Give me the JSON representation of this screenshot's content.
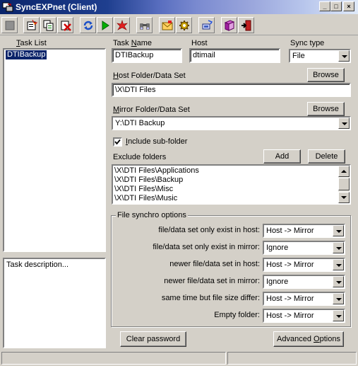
{
  "window": {
    "title": "SyncEXPnet (Client)",
    "minimize_glyph": "_",
    "maximize_glyph": "□",
    "close_glyph": "×"
  },
  "colors": {
    "title_bar": "#0a246a",
    "selection": "#0a246a",
    "face": "#d4d0c8"
  },
  "toolbar": {
    "buttons": [
      {
        "name": "stop-square-icon"
      },
      {
        "name": "new-task-icon"
      },
      {
        "name": "copy-task-icon"
      },
      {
        "name": "delete-task-icon"
      },
      {
        "name": "refresh-sync-icon"
      },
      {
        "name": "play-icon"
      },
      {
        "name": "burst-run-icon"
      },
      {
        "name": "binoculars-icon"
      },
      {
        "name": "mail-icon"
      },
      {
        "name": "gear-settings-icon"
      },
      {
        "name": "computer-network-icon"
      },
      {
        "name": "help-book-icon"
      },
      {
        "name": "exit-door-icon"
      }
    ]
  },
  "task_list": {
    "label_u": "T",
    "label_rest": "ask List",
    "items": [
      "DTIBackup"
    ],
    "description": "Task description..."
  },
  "task": {
    "name_label_pre": "Task ",
    "name_label_u": "N",
    "name_label_post": "ame",
    "name_value": "DTIBackup",
    "host_label": "Host",
    "host_value": "dtimail",
    "sync_type_label": "Sync type",
    "sync_type_value": "File"
  },
  "host_folder": {
    "label_u": "H",
    "label_rest": "ost Folder/Data Set",
    "value": "\\X\\DTI Files",
    "browse_label": "Browse"
  },
  "mirror_folder": {
    "label_u": "M",
    "label_rest": "irror Folder/Data Set",
    "value": "Y:\\DTI Backup",
    "browse_label": "Browse"
  },
  "include_subfolder": {
    "label_u": "I",
    "label_rest": "nclude sub-folder",
    "checked": true
  },
  "exclude": {
    "label": "Exclude folders",
    "add_label": "Add",
    "delete_label": "Delete",
    "items": [
      "\\X\\DTI Files\\Applications",
      "\\X\\DTI Files\\Backup",
      "\\X\\DTI Files\\Misc",
      "\\X\\DTI Files\\Music"
    ]
  },
  "synchro": {
    "title": "File synchro options",
    "options": [
      {
        "label": "file/data set only exist in host:",
        "value": "Host -> Mirror"
      },
      {
        "label": "file/data set only exist in mirror:",
        "value": "Ignore"
      },
      {
        "label": "newer file/data set in host:",
        "value": "Host -> Mirror"
      },
      {
        "label": "newer file/data set in mirror:",
        "value": "Ignore"
      },
      {
        "label": "same time but file size differ:",
        "value": "Host -> Mirror"
      },
      {
        "label": "Empty folder:",
        "value": "Host -> Mirror"
      }
    ]
  },
  "bottom": {
    "clear_password": "Clear password",
    "advanced_pre": "Advanced ",
    "advanced_u": "O",
    "advanced_post": "ptions"
  }
}
